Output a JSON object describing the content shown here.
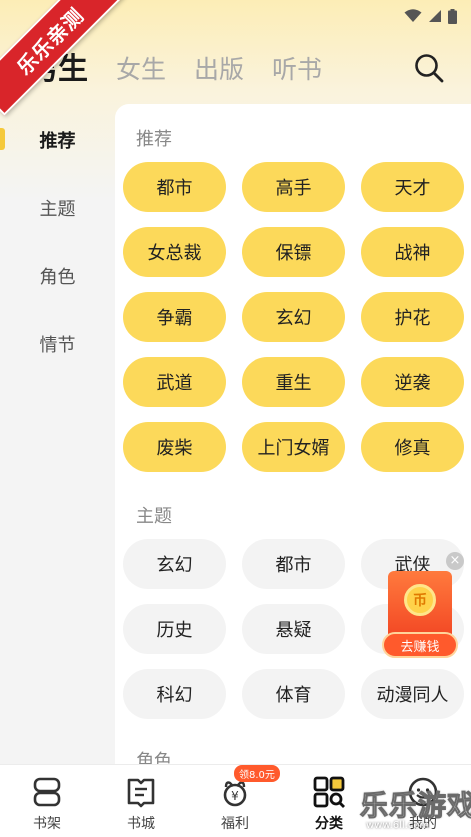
{
  "watermark_ribbon": "乐乐亲测",
  "top_tabs": [
    {
      "label": "男生",
      "active": true
    },
    {
      "label": "女生",
      "active": false
    },
    {
      "label": "出版",
      "active": false
    },
    {
      "label": "听书",
      "active": false
    }
  ],
  "sidebar": {
    "items": [
      {
        "label": "推荐",
        "active": true
      },
      {
        "label": "主题",
        "active": false
      },
      {
        "label": "角色",
        "active": false
      },
      {
        "label": "情节",
        "active": false
      }
    ]
  },
  "sections": {
    "recommend": {
      "title": "推荐",
      "chips": [
        "都市",
        "高手",
        "天才",
        "女总裁",
        "保镖",
        "战神",
        "争霸",
        "玄幻",
        "护花",
        "武道",
        "重生",
        "逆袭",
        "废柴",
        "上门女婿",
        "修真"
      ]
    },
    "theme": {
      "title": "主题",
      "chips": [
        "玄幻",
        "都市",
        "武侠",
        "历史",
        "悬疑",
        "",
        "科幻",
        "体育",
        "动漫同人"
      ]
    },
    "role": {
      "title": "角色"
    }
  },
  "float_ad": {
    "close": "×",
    "coin": "币",
    "label": "去赚钱"
  },
  "bottom_nav": {
    "items": [
      {
        "label": "书架",
        "icon": "bookshelf-icon"
      },
      {
        "label": "书城",
        "icon": "book-city-icon"
      },
      {
        "label": "福利",
        "icon": "welfare-icon",
        "badge": "领8.0元"
      },
      {
        "label": "分类",
        "icon": "category-icon",
        "active": true
      },
      {
        "label": "我的",
        "icon": "profile-icon"
      }
    ]
  },
  "watermark": {
    "text": "乐乐游戏",
    "url": "www.6ll.com"
  },
  "colors": {
    "accent_yellow": "#fcd95a",
    "chip_gray": "#f3f3f3",
    "ribbon_red": "#d9252a",
    "ad_orange": "#ff5a2c"
  }
}
